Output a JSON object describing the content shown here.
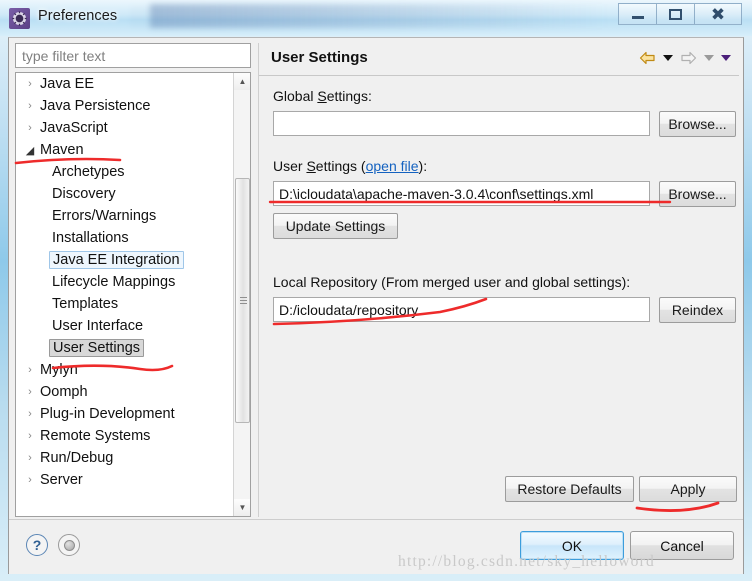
{
  "window": {
    "title": "Preferences",
    "icon": "preferences-gear-icon",
    "controls": {
      "minimize": "–",
      "maximize": "□",
      "close": "✕"
    }
  },
  "sidebar": {
    "filter": {
      "placeholder": "type filter text",
      "value": ""
    },
    "tree": [
      {
        "label": "Java EE",
        "indent": 0,
        "arrow": "collapsed",
        "state": "normal"
      },
      {
        "label": "Java Persistence",
        "indent": 0,
        "arrow": "collapsed",
        "state": "normal"
      },
      {
        "label": "JavaScript",
        "indent": 0,
        "arrow": "collapsed",
        "state": "normal"
      },
      {
        "label": "Maven",
        "indent": 0,
        "arrow": "expanded",
        "state": "normal"
      },
      {
        "label": "Archetypes",
        "indent": 1,
        "arrow": "none",
        "state": "normal"
      },
      {
        "label": "Discovery",
        "indent": 1,
        "arrow": "none",
        "state": "normal"
      },
      {
        "label": "Errors/Warnings",
        "indent": 1,
        "arrow": "none",
        "state": "normal"
      },
      {
        "label": "Installations",
        "indent": 1,
        "arrow": "none",
        "state": "normal"
      },
      {
        "label": "Java EE Integration",
        "indent": 1,
        "arrow": "none",
        "state": "focus-box"
      },
      {
        "label": "Lifecycle Mappings",
        "indent": 1,
        "arrow": "none",
        "state": "normal"
      },
      {
        "label": "Templates",
        "indent": 1,
        "arrow": "none",
        "state": "normal"
      },
      {
        "label": "User Interface",
        "indent": 1,
        "arrow": "none",
        "state": "normal"
      },
      {
        "label": "User Settings",
        "indent": 1,
        "arrow": "none",
        "state": "selected"
      },
      {
        "label": "Mylyn",
        "indent": 0,
        "arrow": "collapsed",
        "state": "normal"
      },
      {
        "label": "Oomph",
        "indent": 0,
        "arrow": "collapsed",
        "state": "normal"
      },
      {
        "label": "Plug-in Development",
        "indent": 0,
        "arrow": "collapsed",
        "state": "normal"
      },
      {
        "label": "Remote Systems",
        "indent": 0,
        "arrow": "collapsed",
        "state": "normal"
      },
      {
        "label": "Run/Debug",
        "indent": 0,
        "arrow": "collapsed",
        "state": "normal"
      },
      {
        "label": "Server",
        "indent": 0,
        "arrow": "collapsed",
        "state": "normal"
      }
    ],
    "scrollbar": {
      "up": "▲",
      "down": "▼"
    }
  },
  "page": {
    "title": "User Settings",
    "nav": {
      "back_icon": "back-arrow-icon",
      "back_menu_icon": "back-dropdown-icon",
      "forward_icon": "forward-arrow-icon",
      "forward_menu_icon": "forward-dropdown-icon",
      "view_menu_icon": "view-menu-dropdown-icon"
    },
    "global_settings": {
      "label_before": "Global ",
      "label_mnemonic": "S",
      "label_after": "ettings:",
      "value": "",
      "browse_label": "Browse..."
    },
    "user_settings": {
      "label_before": "User ",
      "label_mnemonic": "S",
      "label_mid": "ettings (",
      "link": "open file",
      "label_after": "):",
      "value": "D:\\icloudata\\apache-maven-3.0.4\\conf\\settings.xml",
      "browse_label": "Browse...",
      "update_label": "Update Settings"
    },
    "local_repository": {
      "label": "Local Repository (From merged user and global settings):",
      "value": "D:/icloudata/repository",
      "reindex_label": "Reindex"
    },
    "restore_defaults_label": "Restore Defaults",
    "apply_label": "Apply"
  },
  "footer": {
    "help_icon": "help-question-icon",
    "help_glyph": "?",
    "secondary_icon": "gray-circle-icon",
    "ok_label": "OK",
    "cancel_label": "Cancel"
  },
  "watermark": "http://blog.csdn.net/sky_helloword",
  "annotations": {
    "ink_color": "#ee2b2b",
    "underlines": [
      "maven",
      "user-settings-tree-item",
      "user-settings-path",
      "local-repository-path",
      "apply-button"
    ]
  }
}
